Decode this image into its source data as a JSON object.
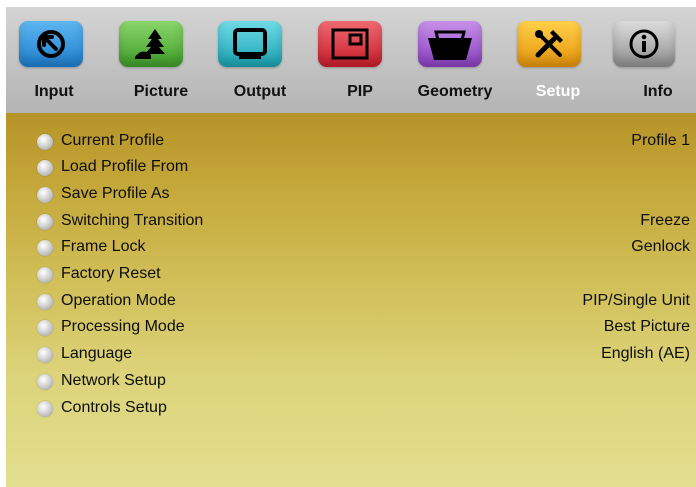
{
  "tabs": [
    {
      "label": "Input",
      "icon": "input-arrow-icon",
      "color": "#2f93de"
    },
    {
      "label": "Picture",
      "icon": "picture-landscape-icon",
      "color": "#52b43b"
    },
    {
      "label": "Output",
      "icon": "monitor-icon",
      "color": "#27b8c6"
    },
    {
      "label": "PIP",
      "icon": "pip-icon",
      "color": "#e32c38"
    },
    {
      "label": "Geometry",
      "icon": "geometry-icon",
      "color": "#9b4fc9"
    },
    {
      "label": "Setup",
      "icon": "tools-icon",
      "color": "#f0a515"
    },
    {
      "label": "Info",
      "icon": "info-icon",
      "color": "#9a9a9a"
    }
  ],
  "active_tab": "Setup",
  "menu": {
    "items": [
      {
        "label": "Current Profile",
        "value": "Profile 1"
      },
      {
        "label": "Load Profile From",
        "value": ""
      },
      {
        "label": "Save Profile As",
        "value": ""
      },
      {
        "label": "Switching Transition",
        "value": "Freeze"
      },
      {
        "label": "Frame Lock",
        "value": "Genlock"
      },
      {
        "label": "Factory Reset",
        "value": ""
      },
      {
        "label": "Operation Mode",
        "value": "PIP/Single Unit"
      },
      {
        "label": "Processing Mode",
        "value": "Best Picture"
      },
      {
        "label": "Language",
        "value": "English (AE)"
      },
      {
        "label": "Network Setup",
        "value": ""
      },
      {
        "label": "Controls Setup",
        "value": ""
      }
    ]
  }
}
